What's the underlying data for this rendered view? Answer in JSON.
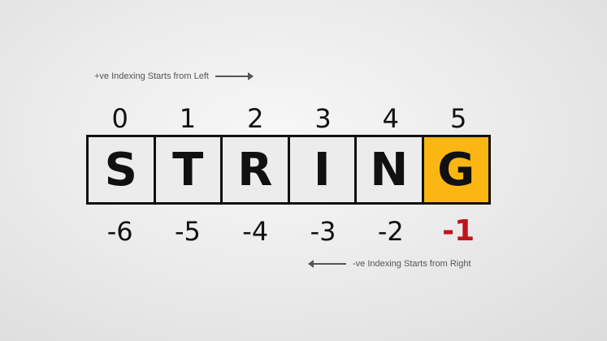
{
  "notes": {
    "positive": "+ve Indexing Starts from Left",
    "negative": "-ve Indexing Starts from Right"
  },
  "positive_indices": [
    "0",
    "1",
    "2",
    "3",
    "4",
    "5"
  ],
  "characters": [
    "S",
    "T",
    "R",
    "I",
    "N",
    "G"
  ],
  "negative_indices": [
    "-6",
    "-5",
    "-4",
    "-3",
    "-2",
    "-1"
  ],
  "colors": {
    "highlight_cell": "#fbb614",
    "highlight_index": "#c0141b"
  }
}
